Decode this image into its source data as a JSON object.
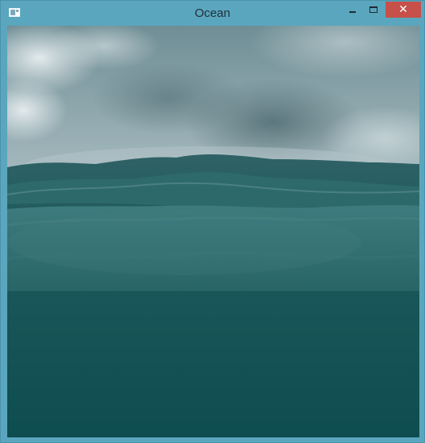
{
  "window": {
    "title": "Ocean",
    "close_glyph": "✕"
  },
  "icons": {
    "app": "app-window-icon",
    "minimize": "minimize-icon",
    "maximize": "maximize-icon",
    "close": "close-icon"
  },
  "colors": {
    "frame": "#5aa6be",
    "close_button": "#c7504a",
    "deep_water": "#0f4f52",
    "sky": "#8fa9af"
  }
}
